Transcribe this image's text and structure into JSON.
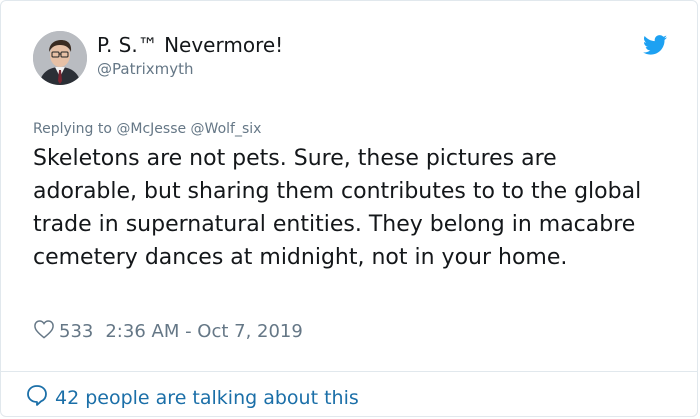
{
  "author": {
    "display_name": "P. S.™ Nevermore!",
    "handle": "@Patrixmyth"
  },
  "reply_context": "Replying to @McJesse @Wolf_six",
  "tweet": {
    "text": "Skeletons are not pets. Sure, these pictures are adorable, but sharing them contributes to to the global trade in supernatural entities. They belong in macabre cemetery dances at midnight, not in your home."
  },
  "stats": {
    "likes": "533",
    "timestamp": "2:36 AM - Oct 7, 2019"
  },
  "footer": {
    "talking_label": "42 people are talking about this"
  },
  "icons": {
    "brand": "twitter-bird-icon",
    "like": "heart-icon",
    "talking": "speech-bubble-icon"
  },
  "colors": {
    "twitter_blue": "#1da1f2",
    "link_blue": "#1b6fa8",
    "muted_text": "#657786",
    "text": "#14171a"
  }
}
